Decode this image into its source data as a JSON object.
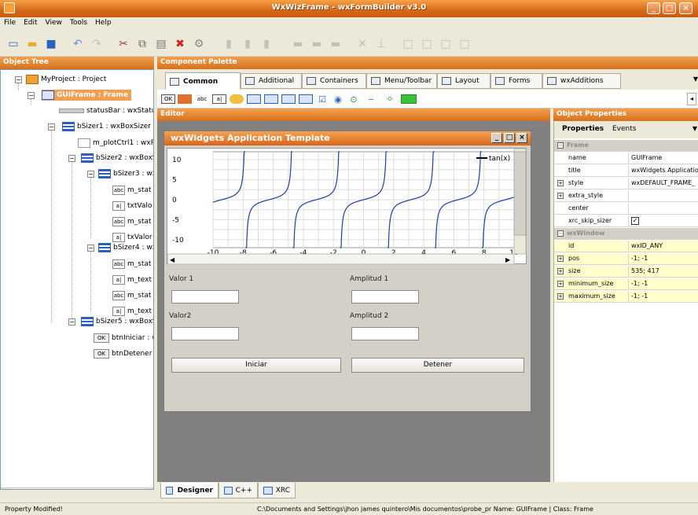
{
  "window": {
    "title": "WxWizFrame - wxFormBuilder v3.0"
  },
  "menu": [
    "File",
    "Edit",
    "View",
    "Tools",
    "Help"
  ],
  "panels": {
    "object_tree": "Object Tree",
    "component_palette": "Component Palette",
    "editor": "Editor",
    "object_properties": "Object Properties"
  },
  "tree": [
    {
      "label": "MyProject : Project",
      "icon": "project-icon"
    },
    {
      "label": "GUIFrame : Frame",
      "icon": "frame-icon",
      "selected": true
    },
    {
      "label": "statusBar : wxStatusB",
      "icon": "statusbar-icon"
    },
    {
      "label": "bSizer1 : wxBoxSizer",
      "icon": "sizer-icon"
    },
    {
      "label": "m_plotCtrl1 : wxP",
      "icon": "plot-icon"
    },
    {
      "label": "bSizer2 : wxBoxS",
      "icon": "sizer-icon"
    },
    {
      "label": "bSizer3 : wx",
      "icon": "sizer-icon"
    },
    {
      "label": "m_stat",
      "icon": "static-text-icon"
    },
    {
      "label": "txtValo",
      "icon": "text-ctrl-icon"
    },
    {
      "label": "m_stat",
      "icon": "static-text-icon"
    },
    {
      "label": "txValor",
      "icon": "text-ctrl-icon"
    },
    {
      "label": "bSizer4 : wx",
      "icon": "sizer-icon"
    },
    {
      "label": "m_stat",
      "icon": "static-text-icon"
    },
    {
      "label": "m_text",
      "icon": "text-ctrl-icon"
    },
    {
      "label": "m_stat",
      "icon": "static-text-icon"
    },
    {
      "label": "m_text",
      "icon": "text-ctrl-icon"
    },
    {
      "label": "bSizer5 : wxBoxS",
      "icon": "sizer-icon"
    },
    {
      "label": "btnIniciar : w",
      "icon": "button-icon"
    },
    {
      "label": "btnDetener",
      "icon": "button-icon"
    }
  ],
  "palette": {
    "tabs": [
      "Common",
      "Additional",
      "Containers",
      "Menu/Toolbar",
      "Layout",
      "Forms",
      "wxAdditions"
    ],
    "active_tab": "Common"
  },
  "designer": {
    "frame_title": "wxWidgets Application Template",
    "labels": {
      "valor1": "Valor 1",
      "amplitud1": "Amplitud 1",
      "valor2": "Valor2",
      "amplitud2": "Amplitud 2"
    },
    "buttons": {
      "iniciar": "Iniciar",
      "detener": "Detener"
    }
  },
  "chart_data": {
    "type": "line",
    "series": [
      {
        "name": "tan(x)"
      }
    ],
    "xlim": [
      -10,
      10
    ],
    "ylim": [
      -12,
      12
    ],
    "x_ticks": [
      -10,
      -8,
      -6,
      -4,
      -2,
      0,
      2,
      4,
      6,
      8,
      10
    ],
    "y_ticks": [
      10,
      5,
      0,
      -5,
      -10
    ],
    "y_tick_labels": [
      "10",
      "5",
      "0",
      "-5",
      "-10"
    ],
    "grid": true,
    "legend": "top-right"
  },
  "properties": {
    "tabs": [
      "Properties",
      "Events"
    ],
    "rows": [
      {
        "category": true,
        "name": "Frame"
      },
      {
        "name": "name",
        "value": "GUIFrame"
      },
      {
        "name": "title",
        "value": "wxWidgets Applicatio"
      },
      {
        "name": "style",
        "value": "wxDEFAULT_FRAME_",
        "expand": true
      },
      {
        "name": "extra_style",
        "value": "",
        "expand": true
      },
      {
        "name": "center",
        "value": ""
      },
      {
        "name": "xrc_skip_sizer",
        "value": "",
        "checkbox": true
      },
      {
        "category": true,
        "name": "wxWindow"
      },
      {
        "name": "id",
        "value": "wxID_ANY",
        "highlight": true
      },
      {
        "name": "pos",
        "value": "-1; -1",
        "expand": true,
        "highlight": true
      },
      {
        "name": "size",
        "value": "535; 417",
        "expand": true,
        "highlight": true
      },
      {
        "name": "minimum_size",
        "value": "-1; -1",
        "expand": true,
        "highlight": true
      },
      {
        "name": "maximum_size",
        "value": "-1; -1",
        "expand": true,
        "highlight": true
      }
    ]
  },
  "bottom_tabs": [
    "Designer",
    "C++",
    "XRC"
  ],
  "status": {
    "left": "Property Modified!",
    "right": "C:\\Documents and Settings\\jhon james quintero\\Mis documentos\\probe_pr Name: GUIFrame | Class: Frame"
  }
}
